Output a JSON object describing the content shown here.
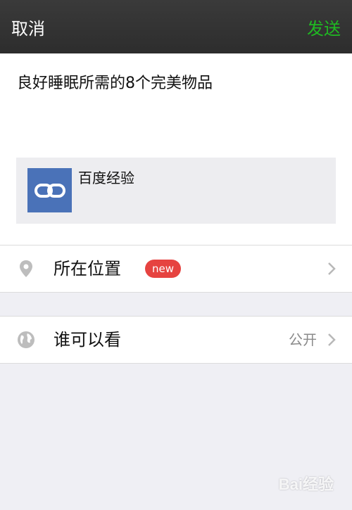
{
  "header": {
    "cancel_label": "取消",
    "send_label": "发送",
    "send_color": "#1fb922"
  },
  "compose": {
    "text": "良好睡眠所需的8个完美物品",
    "link_card": {
      "title": "百度经验",
      "thumb_icon": "link-icon",
      "thumb_color": "#4a72b8"
    }
  },
  "location_row": {
    "icon": "location-pin-icon",
    "label": "所在位置",
    "badge": "new",
    "badge_color": "#e64340"
  },
  "visibility_row": {
    "icon": "globe-icon",
    "label": "谁可以看",
    "value": "公开"
  },
  "watermark": {
    "text": "Bai经验"
  }
}
